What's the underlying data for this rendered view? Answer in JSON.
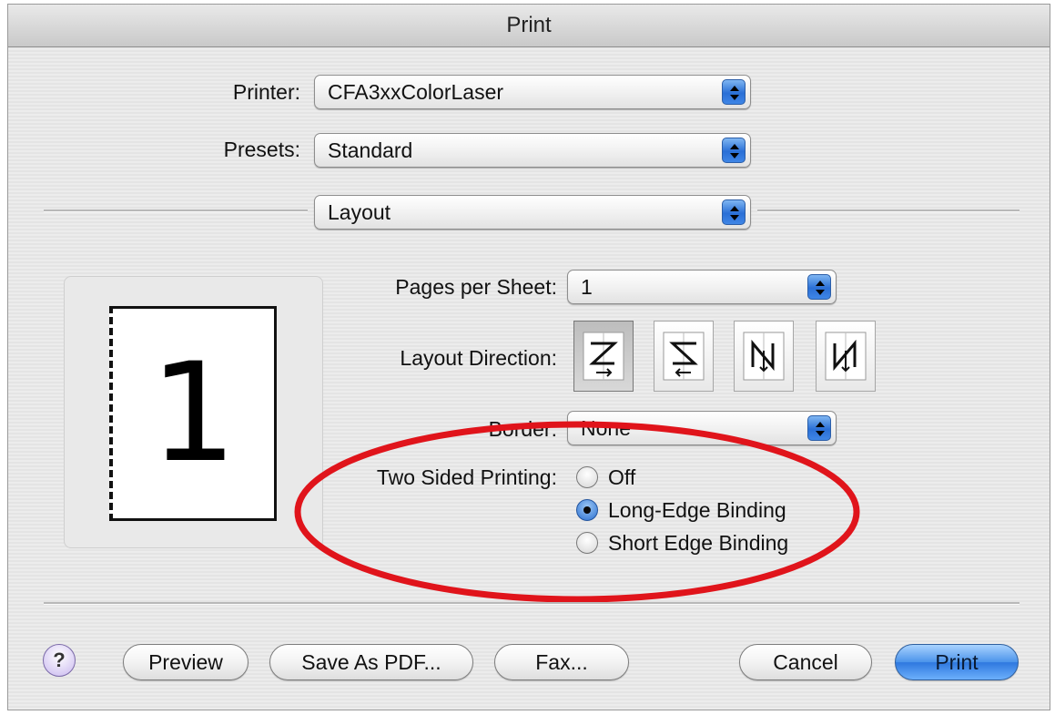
{
  "window": {
    "title": "Print"
  },
  "printer": {
    "label": "Printer:",
    "value": "CFA3xxColorLaser"
  },
  "presets": {
    "label": "Presets:",
    "value": "Standard"
  },
  "panel": {
    "value": "Layout"
  },
  "preview": {
    "page_number": "1"
  },
  "layout": {
    "pages_per_sheet": {
      "label": "Pages per Sheet:",
      "value": "1"
    },
    "direction": {
      "label": "Layout Direction:",
      "options": [
        "z-order-icon",
        "reverse-z-order-icon",
        "n-order-icon",
        "reverse-n-order-icon"
      ],
      "selected_index": 0
    },
    "border": {
      "label": "Border:",
      "value": "None"
    },
    "two_sided": {
      "label": "Two Sided Printing:",
      "options": [
        "Off",
        "Long-Edge Binding",
        "Short Edge Binding"
      ],
      "selected": "Long-Edge Binding"
    }
  },
  "buttons": {
    "help": "?",
    "preview": "Preview",
    "save_pdf": "Save As PDF...",
    "fax": "Fax...",
    "cancel": "Cancel",
    "print": "Print"
  },
  "colors": {
    "highlight_ellipse": "#e0141b",
    "default_button": "#3a82e4"
  }
}
